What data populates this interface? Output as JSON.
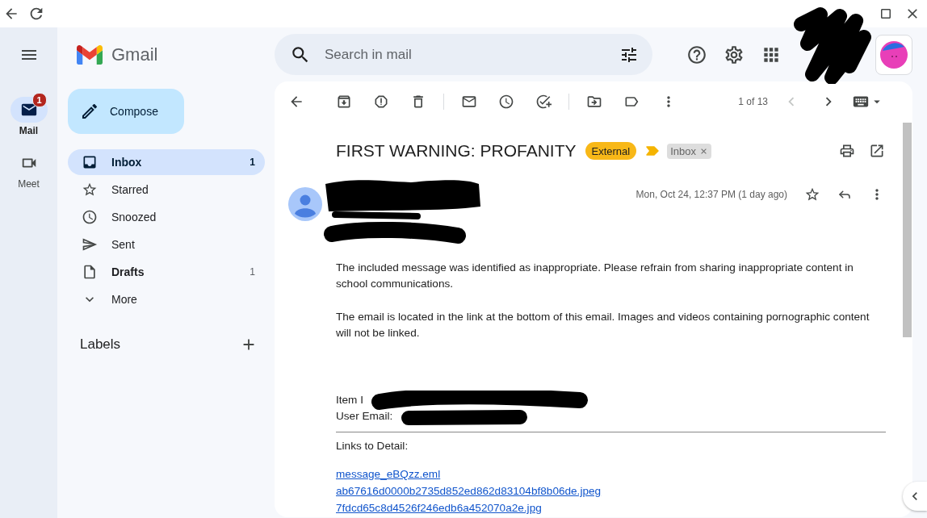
{
  "rail": {
    "items": [
      {
        "label": "Mail",
        "badge": "1",
        "selected": true
      },
      {
        "label": "Meet",
        "selected": false
      }
    ]
  },
  "brand": {
    "name": "Gmail"
  },
  "compose": {
    "label": "Compose"
  },
  "nav": [
    {
      "label": "Inbox",
      "count": "1",
      "selected": true,
      "unread": true
    },
    {
      "label": "Starred",
      "selected": false,
      "unread": false
    },
    {
      "label": "Snoozed",
      "selected": false,
      "unread": false
    },
    {
      "label": "Sent",
      "selected": false,
      "unread": false
    },
    {
      "label": "Drafts",
      "count": "1",
      "selected": false,
      "unread": true
    },
    {
      "label": "More",
      "selected": false,
      "unread": false
    }
  ],
  "labels_section": {
    "title": "Labels"
  },
  "search": {
    "placeholder": "Search in mail"
  },
  "toolbar": {
    "position": "1 of 13",
    "prev": {
      "disabled": true
    },
    "next": {
      "disabled": false
    }
  },
  "message": {
    "subject": "FIRST WARNING: PROFANITY",
    "tags": [
      {
        "kind": "external",
        "label": "External",
        "removable": false
      },
      {
        "kind": "label",
        "label": "Inbox",
        "removable": true
      }
    ],
    "important": true,
    "date": "Mon, Oct 24, 12:37 PM (1 day ago)",
    "starred": false,
    "paragraphs": [
      "The included message was identified as inappropriate. Please refrain from sharing inappropriate content in school communications.",
      "The email is located in the link at the bottom of this email. Images and videos containing pornographic content will not be linked."
    ],
    "fields": [
      "Item I",
      "User Email:"
    ],
    "links_heading": "Links to Detail:",
    "links": [
      "message_eBQzz.eml",
      "ab67616d0000b2735d852ed862d83104bf8b06de.jpeg",
      "7fdcd65c8d4526f246edb6a452070a2e.jpg"
    ]
  }
}
